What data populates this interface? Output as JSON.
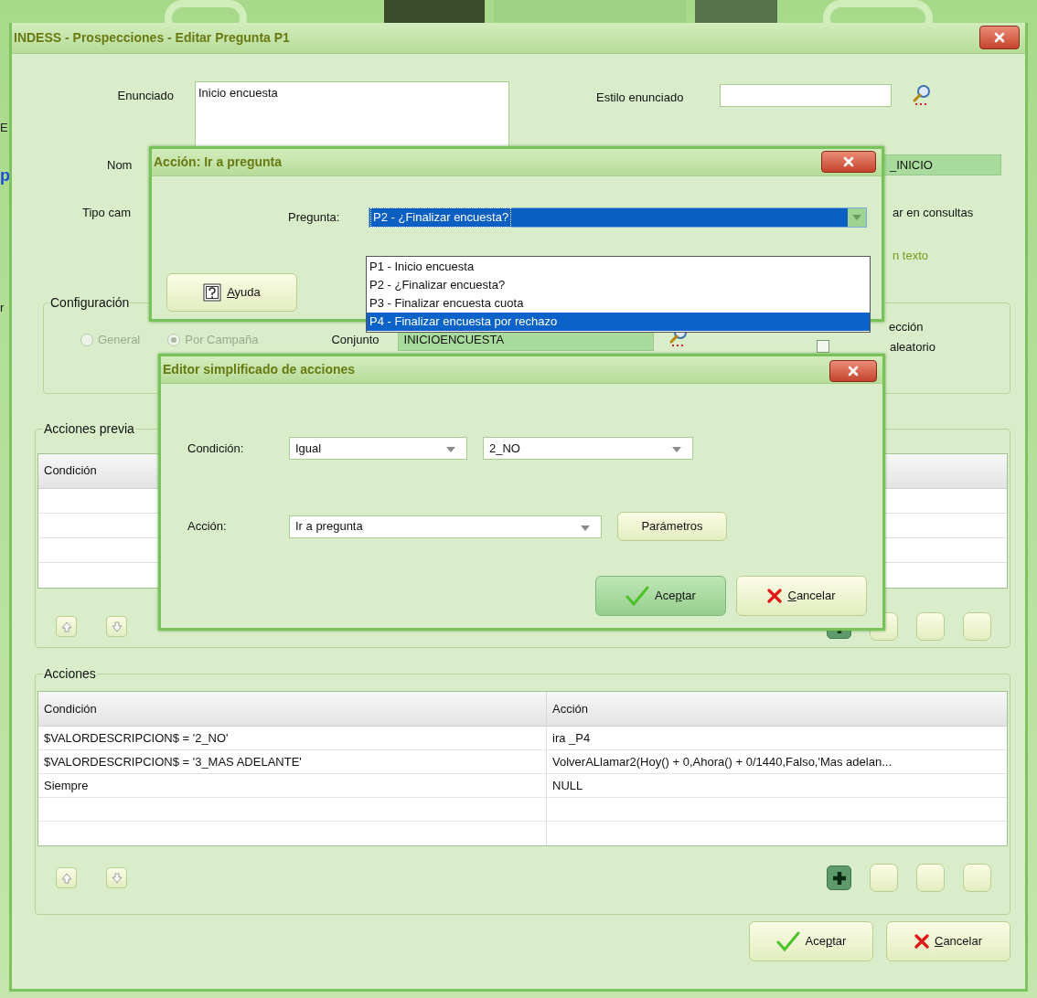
{
  "background_fragments": [
    {
      "text": "E",
      "kind": "plain"
    },
    {
      "text": "p",
      "kind": "link"
    },
    {
      "text": "r",
      "kind": "plain"
    }
  ],
  "window": {
    "title": "INDESS - Prospecciones - Editar Pregunta P1"
  },
  "form": {
    "statement_label": "Enunciado",
    "statement_value": "Inicio encuesta",
    "style_label": "Estilo enunciado",
    "name_label": "Nom",
    "name_value": "_INICIO",
    "type_label": "Tipo cam",
    "queries_text": "ar en consultas",
    "text_link": "n texto"
  },
  "configuration": {
    "legend": "Configuración",
    "disabled": true,
    "radios": [
      {
        "label": "General",
        "selected": false
      },
      {
        "label": "Por Campaña",
        "selected": true
      }
    ],
    "set_label": "Conjunto",
    "set_value": "INICIOENCUESTA",
    "right_text": "ección",
    "random_label": "aleatorio",
    "random_checked": false
  },
  "pre_actions": {
    "legend": "Acciones previa",
    "columns": [
      "Condición"
    ]
  },
  "actions": {
    "legend": "Acciones",
    "columns": [
      "Condición",
      "Acción"
    ],
    "rows": [
      [
        "$VALORDESCRIPCION$ = '2_NO'",
        "ira _P4"
      ],
      [
        "$VALORDESCRIPCION$ = '3_MAS ADELANTE'",
        "VolverALlamar2(Hoy() + 0,Ahora() + 0/1440,Falso,'Mas adelan..."
      ],
      [
        "Siempre",
        "NULL"
      ]
    ]
  },
  "buttons": [
    {
      "kind": "ok",
      "before": "Ace",
      "accel": "p",
      "after": "tar"
    },
    {
      "kind": "cancel",
      "accel": "C",
      "after": "ancelar"
    }
  ],
  "question_dialog": {
    "title": "Acción: Ir a pregunta",
    "question_label": "Pregunta:",
    "question_value": "P2 - ¿Finalizar encuesta?",
    "options": [
      {
        "label": "P1 - Inicio encuesta",
        "selected": false
      },
      {
        "label": "P2 - ¿Finalizar encuesta?",
        "selected": false
      },
      {
        "label": "P3 - Finalizar encuesta cuota",
        "selected": false
      },
      {
        "label": "P4 - Finalizar encuesta por rechazo",
        "selected": true
      }
    ],
    "help_button": {
      "kind": "help",
      "accel": "A",
      "after": "yuda"
    }
  },
  "editor_dialog": {
    "title": "Editor simplificado de acciones",
    "condition_label": "Condición:",
    "operator": "Igual",
    "value": "2_NO",
    "action_label": "Acción:",
    "action": "Ir a pregunta",
    "params_button": "Parámetros",
    "buttons": [
      {
        "kind": "ok",
        "focused": true,
        "before": "Ace",
        "accel": "p",
        "after": "tar"
      },
      {
        "kind": "cancel",
        "focused": false,
        "accel": "C",
        "after": "ancelar"
      }
    ]
  }
}
